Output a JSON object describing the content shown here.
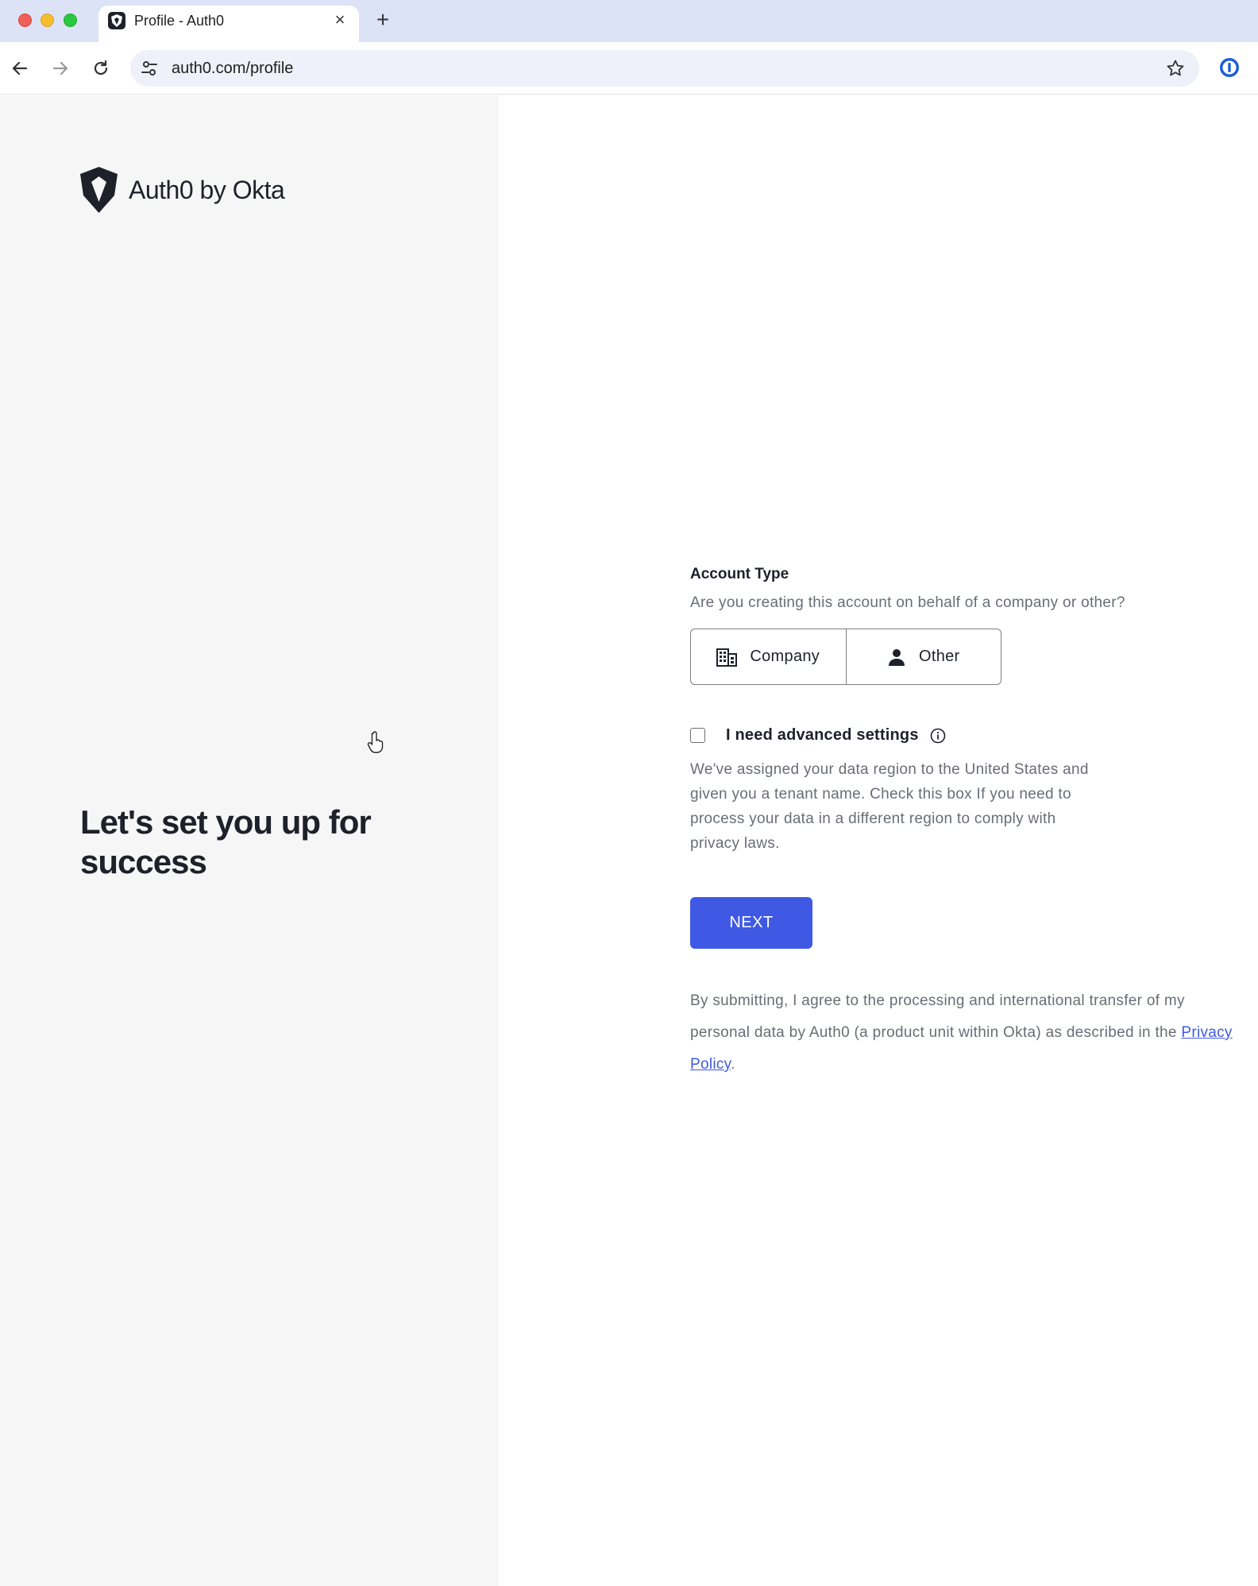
{
  "browser": {
    "tab_title": "Profile - Auth0",
    "url": "auth0.com/profile"
  },
  "brand": {
    "logo_text": "Auth0 by Okta",
    "hero": "Let's set you up for success"
  },
  "account_type": {
    "label": "Account Type",
    "question": "Are you creating this account on behalf of a company or other?",
    "options": [
      {
        "label": "Company",
        "icon": "building-icon"
      },
      {
        "label": "Other",
        "icon": "person-icon"
      }
    ]
  },
  "advanced": {
    "label": "I need advanced settings",
    "checked": false,
    "description": "We've assigned your data region to the United States and given you a tenant name. Check this box If you need to process your data in a different region to comply with privacy laws."
  },
  "next_button": "NEXT",
  "legal": {
    "text": "By submitting, I agree to the processing and international transfer of my personal data by Auth0 (a product unit within Okta) as described in the",
    "link": "Privacy Policy",
    "suffix": "."
  },
  "colors": {
    "primary": "#3f59e4",
    "left_panel": "#f6f6f6",
    "tabbar": "#dde3f7"
  }
}
